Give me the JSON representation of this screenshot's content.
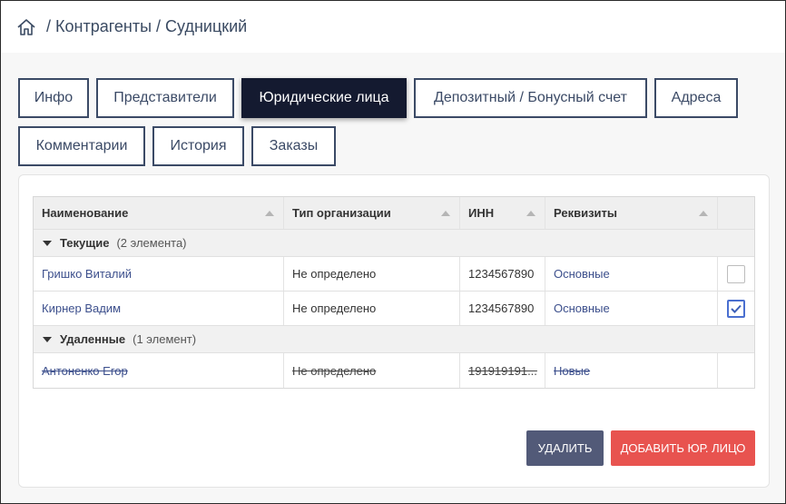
{
  "breadcrumb": {
    "section": "Контрагенты",
    "item": "Судницкий",
    "separator": "/"
  },
  "tabs": [
    {
      "label": "Инфо",
      "active": false
    },
    {
      "label": "Представители",
      "active": false
    },
    {
      "label": "Юридические лица",
      "active": true
    },
    {
      "label": "Депозитный / Бонусный счет",
      "active": false
    },
    {
      "label": "Адреса",
      "active": false
    },
    {
      "label": "Комментарии",
      "active": false
    },
    {
      "label": "История",
      "active": false
    },
    {
      "label": "Заказы",
      "active": false
    }
  ],
  "table": {
    "columns": [
      "Наименование",
      "Тип организации",
      "ИНН",
      "Реквизиты"
    ],
    "groups": [
      {
        "title": "Текущие",
        "count": "(2 элемента)",
        "rows": [
          {
            "name": "Гришко Виталий",
            "type": "Не определено",
            "inn": "1234567890",
            "details": "Основные",
            "checked": false
          },
          {
            "name": "Кирнер Вадим",
            "type": "Не определено",
            "inn": "1234567890",
            "details": "Основные",
            "checked": true
          }
        ]
      },
      {
        "title": "Удаленные",
        "count": "(1 элемент)",
        "rows": [
          {
            "name": "Антоненко Егор",
            "type": "Не определено",
            "inn": "191919191...",
            "details": "Новые"
          }
        ]
      }
    ]
  },
  "buttons": {
    "delete": "УДАЛИТЬ",
    "add": "ДОБАВИТЬ ЮР. ЛИЦО"
  },
  "colors": {
    "accent_dark": "#141a30",
    "delete_button": "#525a78",
    "add_button": "#e8534f",
    "link": "#3c4f8c"
  }
}
